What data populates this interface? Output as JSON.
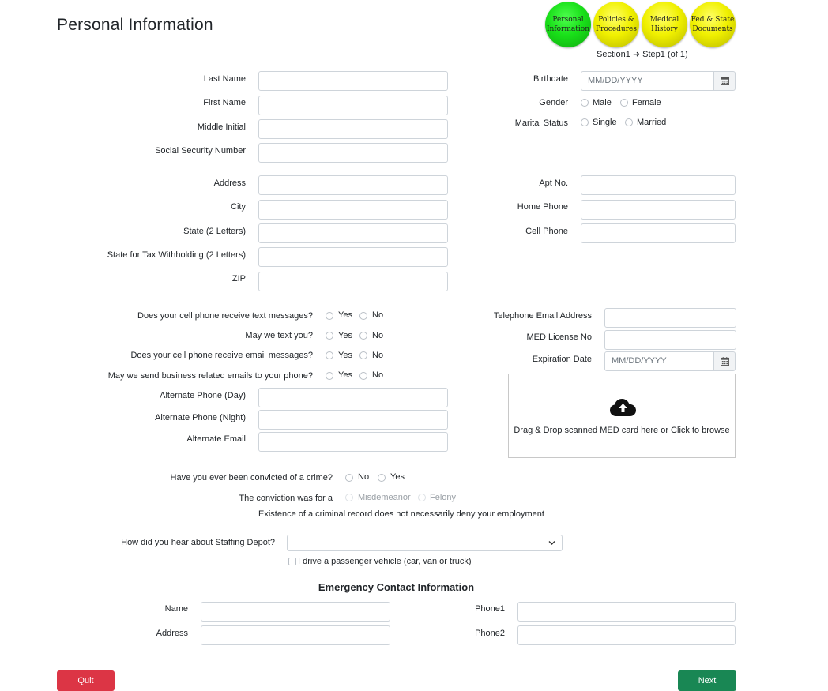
{
  "page_title": "Personal Information",
  "steps": [
    {
      "label": "Personal Information",
      "color": "#19e019",
      "active": true
    },
    {
      "label": "Policies & Procedures",
      "color": "#f0f000",
      "active": false
    },
    {
      "label": "Medical History",
      "color": "#f0f000",
      "active": false
    },
    {
      "label": "Fed & State Documents",
      "color": "#f0f000",
      "active": false
    }
  ],
  "progress": {
    "section": "Section1",
    "step": "Step1 (of 1)"
  },
  "personal": {
    "last_name": "Last Name",
    "first_name": "First Name",
    "middle_initial": "Middle Initial",
    "ssn": "Social Security Number",
    "birthdate": "Birthdate",
    "birthdate_placeholder": "MM/DD/YYYY",
    "gender": "Gender",
    "gender_male": "Male",
    "gender_female": "Female",
    "marital_status": "Marital Status",
    "marital_single": "Single",
    "marital_married": "Married"
  },
  "address": {
    "address": "Address",
    "city": "City",
    "state": "State (2 Letters)",
    "tax_state": "State for Tax Withholding (2 Letters)",
    "zip": "ZIP",
    "apt": "Apt No.",
    "home_phone": "Home Phone",
    "cell_phone": "Cell Phone"
  },
  "contact": {
    "q_text_messages": "Does your cell phone receive text messages?",
    "q_may_text": "May we text you?",
    "q_email_messages": "Does your cell phone receive email messages?",
    "q_business_emails": "May we send business related emails to your phone?",
    "yes": "Yes",
    "no": "No",
    "alt_phone_day": "Alternate Phone (Day)",
    "alt_phone_night": "Alternate Phone (Night)",
    "alt_email": "Alternate Email",
    "telephone_email": "Telephone Email Address",
    "med_license": "MED License No",
    "expiration": "Expiration Date",
    "expiration_placeholder": "MM/DD/YYYY",
    "dropzone_text": "Drag & Drop scanned MED card here or Click to browse"
  },
  "criminal": {
    "question": "Have you ever been convicted of a crime?",
    "no": "No",
    "yes": "Yes",
    "conviction_label": "The conviction was for a",
    "misdemeanor": "Misdemeanor",
    "felony": "Felony",
    "note": "Existence of a criminal record does not necessarily deny your employment"
  },
  "referral": {
    "question": "How did you hear about Staffing Depot?",
    "selected": "",
    "vehicle_label": "I drive a passenger vehicle (car, van or truck)"
  },
  "emergency": {
    "heading": "Emergency Contact Information",
    "name": "Name",
    "address": "Address",
    "phone1": "Phone1",
    "phone2": "Phone2"
  },
  "buttons": {
    "quit": "Quit",
    "quit_color": "#dc3545",
    "next": "Next",
    "next_color": "#198754"
  }
}
